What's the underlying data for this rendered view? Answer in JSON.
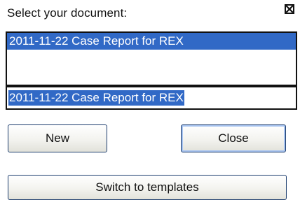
{
  "dialog": {
    "prompt": "Select your document:",
    "close_icon": "close-x-icon"
  },
  "document_list": {
    "items": [
      {
        "label": "2011-11-22 Case Report for REX",
        "selected": true
      }
    ]
  },
  "document_name_field": {
    "value": "2011-11-22 Case Report for REX"
  },
  "buttons": {
    "new_label": "New",
    "close_label": "Close",
    "switch_label": "Switch to templates"
  },
  "colors": {
    "selection": "#3169c6",
    "selection_text": "#ffffff",
    "border": "#111111"
  }
}
